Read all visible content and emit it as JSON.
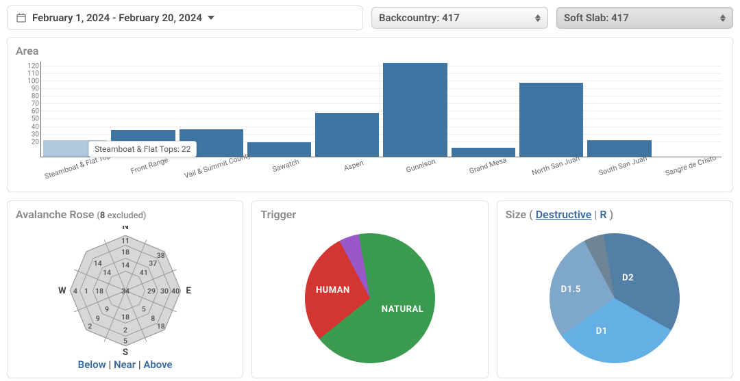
{
  "date_range": {
    "label": "February 1, 2024 - February 20, 2024"
  },
  "filters": {
    "zone": "Backcountry: 417",
    "type": "Soft Slab: 417"
  },
  "area_panel": {
    "title": "Area",
    "tooltip": "Steamboat & Flat Tops: 22"
  },
  "chart_data": {
    "type": "bar",
    "title": "Area",
    "xlabel": "",
    "ylabel": "",
    "ylim": [
      0,
      125
    ],
    "yticks": [
      20,
      30,
      40,
      50,
      60,
      70,
      80,
      90,
      100,
      110,
      120
    ],
    "categories": [
      "Steamboat & Flat Tops",
      "Front Range",
      "Vail & Summit County",
      "Sawatch",
      "Aspen",
      "Gunnison",
      "Grand Mesa",
      "North San Juan",
      "South San Juan",
      "Sangre de Cristo"
    ],
    "values": [
      22,
      35,
      36,
      19,
      58,
      123,
      12,
      97,
      22,
      0
    ],
    "hover_index": 0
  },
  "rose_panel": {
    "title": "Avalanche Rose",
    "excluded_label": "(8 excluded)",
    "compass": {
      "N": "N",
      "S": "S",
      "E": "E",
      "W": "W"
    },
    "rings": {
      "outer": [
        11,
        38,
        40,
        18,
        5,
        2,
        4,
        ""
      ],
      "middle": [
        18,
        37,
        30,
        8,
        2,
        9,
        1,
        14
      ],
      "inner": [
        14,
        41,
        29,
        5,
        18,
        9,
        18,
        14
      ],
      "center": 34
    },
    "legend": [
      "Below",
      "Near",
      "Above"
    ]
  },
  "trigger_panel": {
    "title": "Trigger",
    "slices": [
      {
        "label": "NATURAL",
        "value": 67,
        "color": "#3a9b4e"
      },
      {
        "label": "HUMAN",
        "value": 28,
        "color": "#d33531"
      },
      {
        "label": "",
        "value": 5,
        "color": "#9a57c9"
      }
    ]
  },
  "size_panel": {
    "title": "Size",
    "mode_labels": {
      "destructive": "Destructive",
      "r": "R"
    },
    "slices": [
      {
        "label": "D2",
        "value": 36,
        "color": "#537fa6"
      },
      {
        "label": "D1",
        "value": 32,
        "color": "#64b0e4"
      },
      {
        "label": "D1.5",
        "value": 27,
        "color": "#7ea7c9"
      },
      {
        "label": "",
        "value": 5,
        "color": "#6e8598"
      }
    ]
  }
}
